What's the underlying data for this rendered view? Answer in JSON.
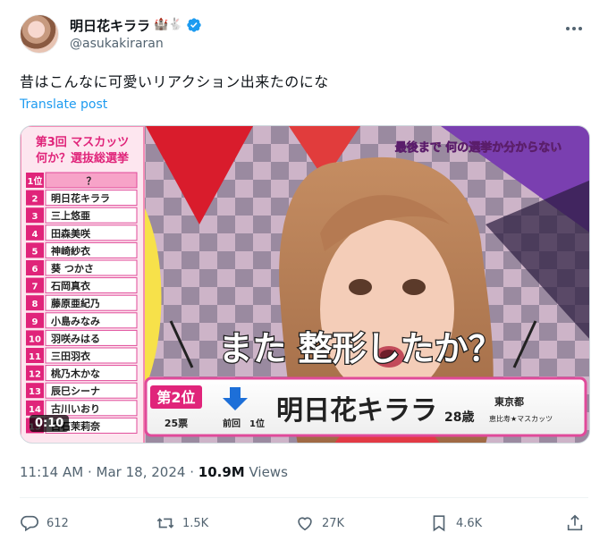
{
  "user": {
    "display_name": "明日花キララ",
    "emoji": "🏰🐇",
    "handle": "@asukakiraran",
    "avatar": "profile-photo"
  },
  "tweet": {
    "text": "昔はこんなに可愛いリアクション出来たのにな",
    "translate_label": "Translate post"
  },
  "video": {
    "duration": "0:10",
    "overlay": {
      "ranking_title_1": "第3回 マスカッツ",
      "ranking_title_2": "何か？選抜総選挙",
      "ranking": [
        {
          "rank": "1位",
          "name": "？"
        },
        {
          "rank": "2",
          "name": "明日花キララ"
        },
        {
          "rank": "3",
          "name": "三上悠亜"
        },
        {
          "rank": "4",
          "name": "田森美咲"
        },
        {
          "rank": "5",
          "name": "神崎紗衣"
        },
        {
          "rank": "6",
          "name": "葵 つかさ"
        },
        {
          "rank": "7",
          "name": "石岡真衣"
        },
        {
          "rank": "8",
          "name": "藤原亜紀乃"
        },
        {
          "rank": "9",
          "name": "小島みなみ"
        },
        {
          "rank": "10",
          "name": "羽咲みはる"
        },
        {
          "rank": "11",
          "name": "三田羽衣"
        },
        {
          "rank": "12",
          "name": "桃乃木かな"
        },
        {
          "rank": "13",
          "name": "辰巳シーナ"
        },
        {
          "rank": "14",
          "name": "古川いおり"
        },
        {
          "rank": "15",
          "name": "白石茉莉奈"
        }
      ],
      "top_caption": "最後まで 何の選挙か分からない",
      "main_caption": "また 整形したか？",
      "nameplate": {
        "rank_label": "第2位",
        "votes": "25票",
        "prev_label": "前回",
        "prev_rank": "1位",
        "name": "明日花キララ",
        "age": "28歳",
        "location": "東京都",
        "group": "恵比寿★マスカッツ"
      }
    }
  },
  "meta": {
    "time": "11:14 AM",
    "sep": "·",
    "date": "Mar 18, 2024",
    "views_count": "10.9M",
    "views_label": "Views"
  },
  "actions": {
    "replies": "612",
    "reposts": "1.5K",
    "likes": "27K",
    "bookmarks": "4.6K"
  },
  "colors": {
    "link": "#1d9bf0",
    "text": "#0f1419",
    "muted": "#536471",
    "verified": "#1d9bf0"
  }
}
